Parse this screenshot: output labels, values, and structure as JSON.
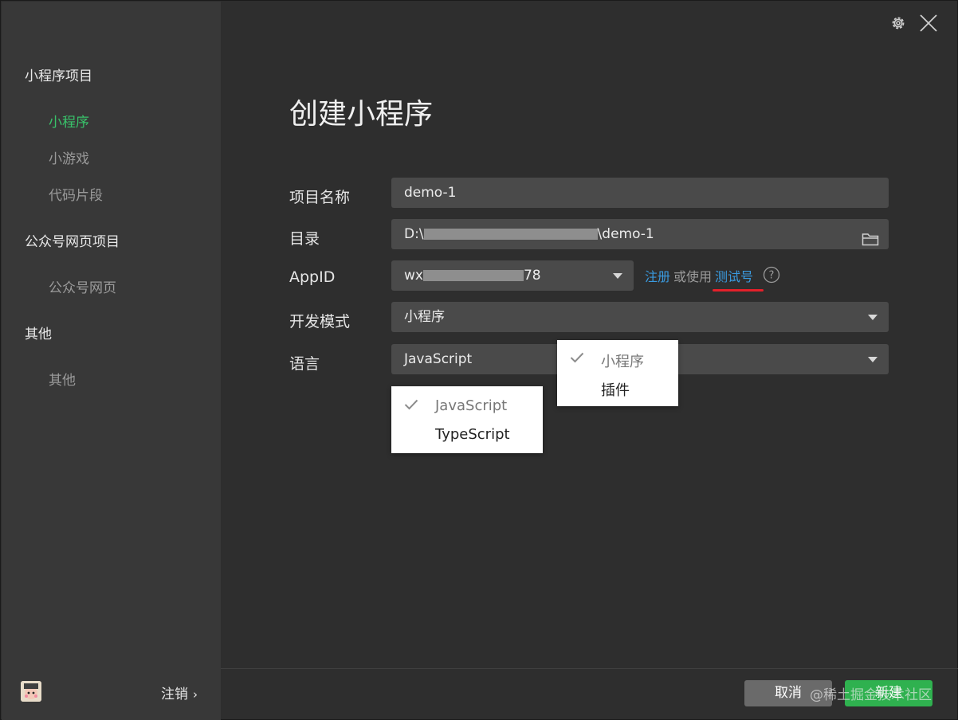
{
  "sidebar": {
    "sections": [
      {
        "title": "小程序项目",
        "items": [
          "小程序",
          "小游戏",
          "代码片段"
        ]
      },
      {
        "title": "公众号网页项目",
        "items": [
          "公众号网页"
        ]
      },
      {
        "title": "其他",
        "items": [
          "其他"
        ]
      }
    ],
    "active_item": "小程序",
    "logout_label": "注销",
    "logout_chevron": "›"
  },
  "header": {
    "title": "创建小程序"
  },
  "form": {
    "project_name": {
      "label": "项目名称",
      "value": "demo-1"
    },
    "directory": {
      "label": "目录",
      "value_prefix": "D:\\",
      "value_suffix": "\\demo-1"
    },
    "appid": {
      "label": "AppID",
      "value_prefix": "wx",
      "value_suffix": "78",
      "register_link": "注册",
      "or_use": "或使用",
      "test_account_link": "测试号",
      "help_glyph": "?"
    },
    "dev_mode": {
      "label": "开发模式",
      "value": "小程序"
    },
    "language": {
      "label": "语言",
      "value": "JavaScript"
    }
  },
  "dropdowns": {
    "language_options": [
      "JavaScript",
      "TypeScript"
    ],
    "language_selected": "JavaScript",
    "dev_mode_options": [
      "小程序",
      "插件"
    ],
    "dev_mode_selected": "小程序"
  },
  "footer": {
    "cancel_label": "取消",
    "create_label": "新建",
    "watermark": "@稀土掘金技术社区"
  },
  "colors": {
    "accent_green": "#39c26a",
    "link_blue": "#3a9be0",
    "underline_red": "#e4202a",
    "create_green": "#2fb14f"
  }
}
